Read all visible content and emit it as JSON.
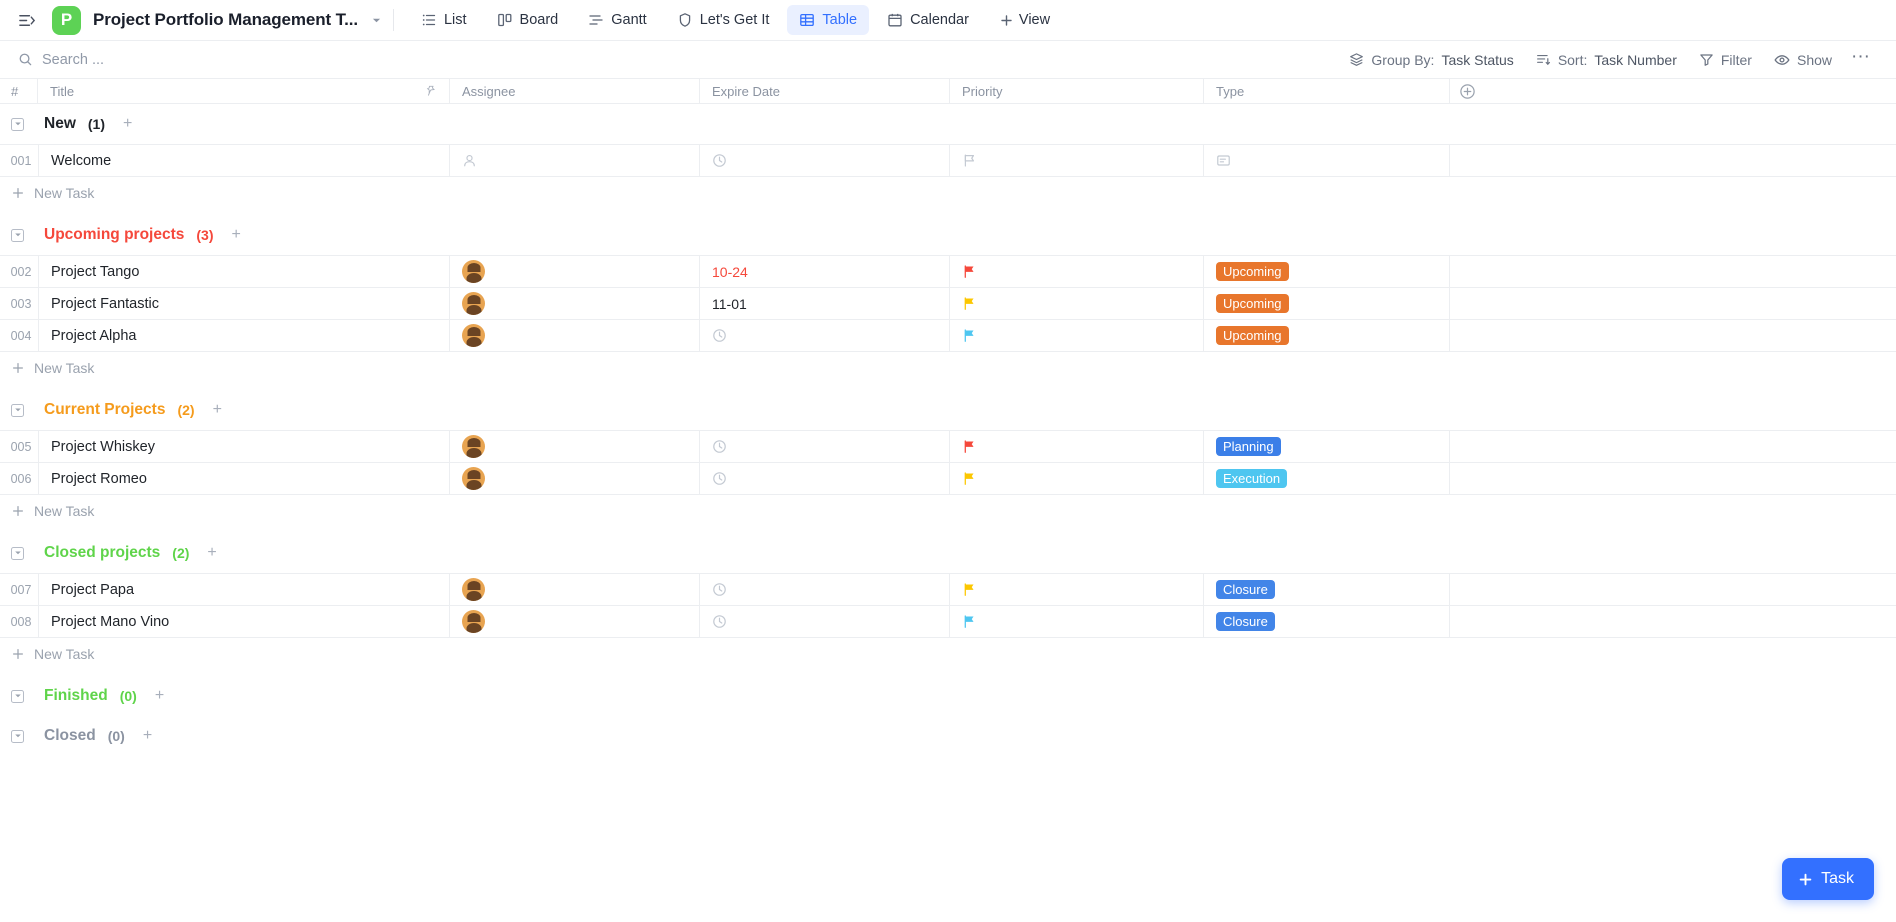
{
  "topbar": {
    "menu_toggle_icon": "sidebar-collapse-icon",
    "logo_letter": "P",
    "logo_color": "#5dd255",
    "title": "Project Portfolio Management T...",
    "title_caret": "▼",
    "tabs": [
      {
        "label": "List",
        "icon": "list-icon",
        "active": false
      },
      {
        "label": "Board",
        "icon": "board-icon",
        "active": false
      },
      {
        "label": "Gantt",
        "icon": "gantt-icon",
        "active": false
      },
      {
        "label": "Let's Get It",
        "icon": "shield-icon",
        "active": false
      },
      {
        "label": "Table",
        "icon": "table-icon",
        "active": true
      },
      {
        "label": "Calendar",
        "icon": "calendar-icon",
        "active": false
      }
    ],
    "add_view_label": "View",
    "add_view_icon": "plus-icon",
    "active_tab_color": "#3370ff"
  },
  "toolbar": {
    "search_placeholder": "Search ...",
    "search_icon": "search-icon",
    "group_by_key": "Group By:",
    "group_by_value": "Task Status",
    "group_by_icon": "layers-icon",
    "sort_key": "Sort:",
    "sort_value": "Task Number",
    "sort_icon": "sort-icon",
    "filter_label": "Filter",
    "filter_icon": "funnel-icon",
    "show_label": "Show",
    "show_icon": "eye-icon",
    "more_label": "···",
    "more_icon": "more-horizontal-icon"
  },
  "table": {
    "columns": [
      {
        "label": "#",
        "name": "number"
      },
      {
        "label": "Title",
        "name": "title",
        "pin_icon": "pin-icon"
      },
      {
        "label": "Assignee",
        "name": "assignee"
      },
      {
        "label": "Expire Date",
        "name": "expire-date"
      },
      {
        "label": "Priority",
        "name": "priority"
      },
      {
        "label": "Type",
        "name": "type"
      }
    ],
    "add_column_icon": "plus-circle-icon",
    "new_task_label": "New Task",
    "new_task_icon": "plus-icon",
    "collapse_icon": "chevron-down-box-icon",
    "group_add_icon": "plus-icon"
  },
  "groups": [
    {
      "name": "New",
      "count": "(1)",
      "color": "#1f2329",
      "rows": [
        {
          "num": "001",
          "title": "Welcome",
          "assignee": "",
          "assignee_icon": "user-placeholder-icon",
          "date": "",
          "date_icon": "clock-icon",
          "date_overdue": false,
          "priority_flag": "",
          "priority_icon": "flag-outline-icon",
          "type": "",
          "type_icon": "tag-outline-icon",
          "type_color": ""
        }
      ]
    },
    {
      "name": "Upcoming projects",
      "count": "(3)",
      "color": "#f5483b",
      "rows": [
        {
          "num": "002",
          "title": "Project Tango",
          "assignee": "avatar",
          "date": "10-24",
          "date_overdue": true,
          "priority_flag": "#f5483b",
          "priority_icon": "flag-icon",
          "type": "Upcoming",
          "type_color": "#e8762c"
        },
        {
          "num": "003",
          "title": "Project Fantastic",
          "assignee": "avatar",
          "date": "11-01",
          "date_overdue": false,
          "priority_flag": "#fcc700",
          "priority_icon": "flag-icon",
          "type": "Upcoming",
          "type_color": "#e8762c"
        },
        {
          "num": "004",
          "title": "Project Alpha",
          "assignee": "avatar",
          "date": "",
          "date_icon": "clock-icon",
          "date_overdue": false,
          "priority_flag": "#4ec6f0",
          "priority_icon": "flag-icon",
          "type": "Upcoming",
          "type_color": "#e8762c"
        }
      ]
    },
    {
      "name": "Current Projects",
      "count": "(2)",
      "color": "#f59b1c",
      "rows": [
        {
          "num": "005",
          "title": "Project Whiskey",
          "assignee": "avatar",
          "date": "",
          "date_icon": "clock-icon",
          "date_overdue": false,
          "priority_flag": "#f5483b",
          "priority_icon": "flag-icon",
          "type": "Planning",
          "type_color": "#3b7fe8"
        },
        {
          "num": "006",
          "title": "Project Romeo",
          "assignee": "avatar",
          "date": "",
          "date_icon": "clock-icon",
          "date_overdue": false,
          "priority_flag": "#fcc700",
          "priority_icon": "flag-icon",
          "type": "Execution",
          "type_color": "#4ec6f0"
        }
      ]
    },
    {
      "name": "Closed projects",
      "count": "(2)",
      "color": "#5fd44a",
      "rows": [
        {
          "num": "007",
          "title": "Project Papa",
          "assignee": "avatar",
          "date": "",
          "date_icon": "clock-icon",
          "date_overdue": false,
          "priority_flag": "#fcc700",
          "priority_icon": "flag-icon",
          "type": "Closure",
          "type_color": "#4285e8"
        },
        {
          "num": "008",
          "title": "Project Mano Vino",
          "assignee": "avatar",
          "date": "",
          "date_icon": "clock-icon",
          "date_overdue": false,
          "priority_flag": "#4ec6f0",
          "priority_icon": "flag-icon",
          "type": "Closure",
          "type_color": "#4285e8"
        }
      ]
    },
    {
      "name": "Finished",
      "count": "(0)",
      "color": "#5fd44a",
      "rows": []
    },
    {
      "name": "Closed",
      "count": "(0)",
      "color": "#8b93a1",
      "rows": []
    }
  ],
  "fab": {
    "label": "Task",
    "icon": "plus-icon",
    "color": "#3370ff"
  }
}
